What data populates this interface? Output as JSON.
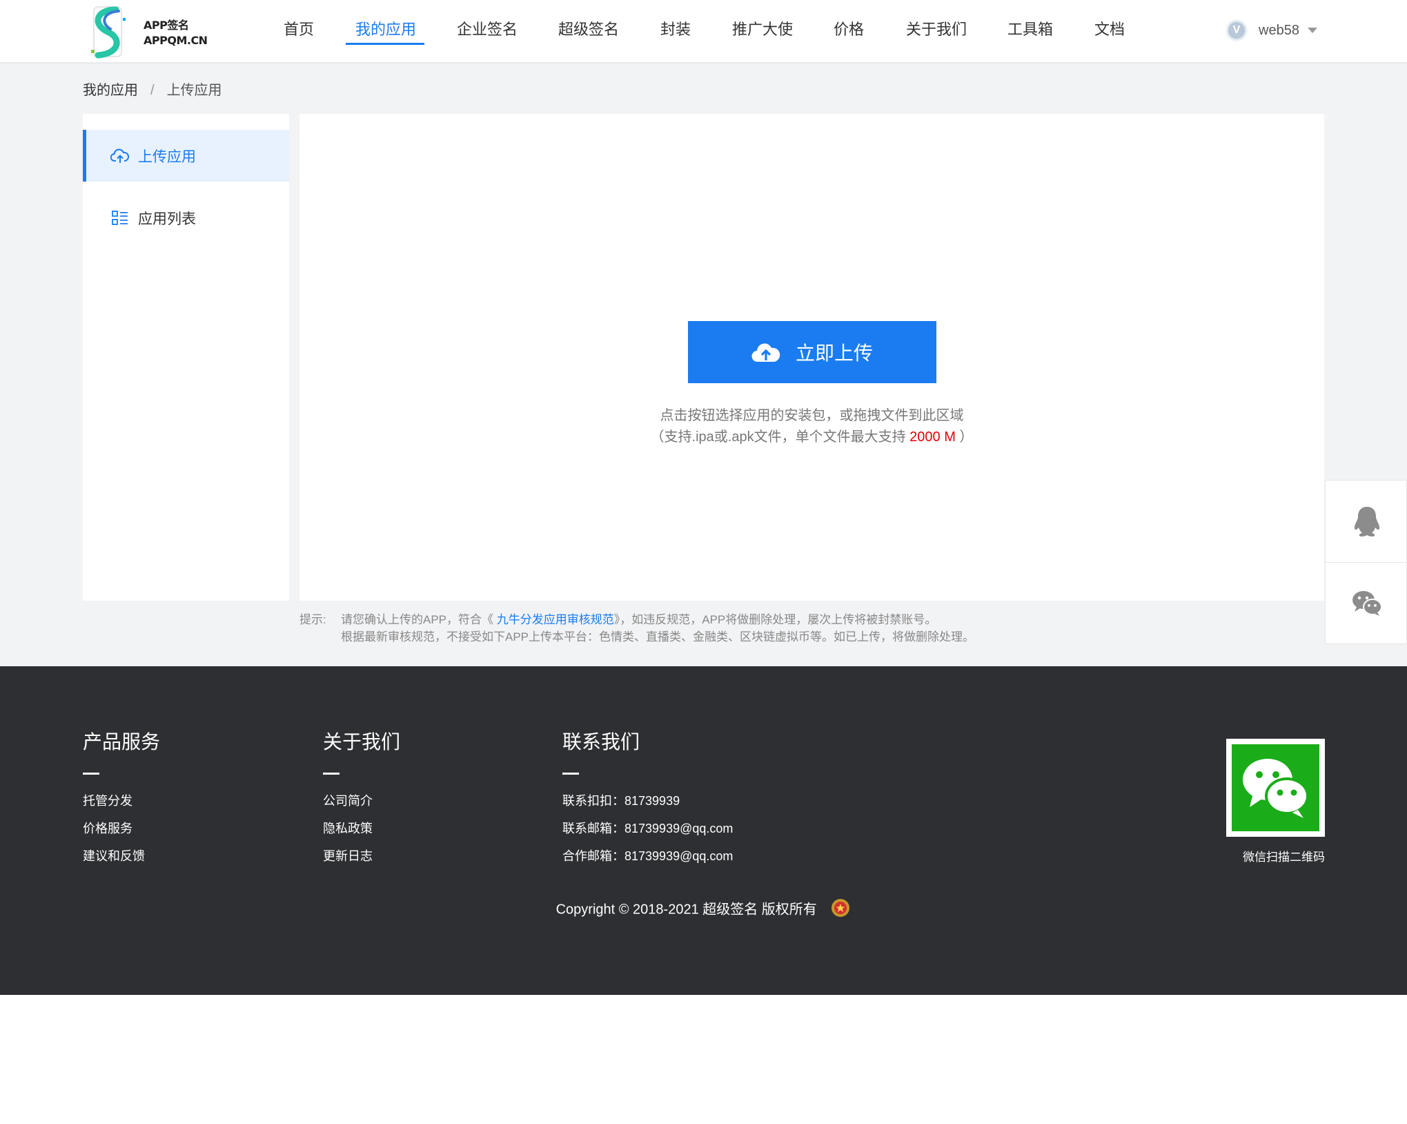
{
  "header": {
    "logo_line1": "APP签名",
    "logo_line2": "APPQM.CN",
    "nav": [
      {
        "label": "首页"
      },
      {
        "label": "我的应用"
      },
      {
        "label": "企业签名"
      },
      {
        "label": "超级签名"
      },
      {
        "label": "封装"
      },
      {
        "label": "推广大使"
      },
      {
        "label": "价格"
      },
      {
        "label": "关于我们"
      },
      {
        "label": "工具箱"
      },
      {
        "label": "文档"
      }
    ],
    "active_nav": "我的应用",
    "avatar_letter": "V",
    "username": "web58"
  },
  "breadcrumb": {
    "parent": "我的应用",
    "separator": "/",
    "current": "上传应用"
  },
  "sidebar": {
    "items": [
      {
        "label": "上传应用",
        "icon": "cloud-upload-icon",
        "active": true
      },
      {
        "label": "应用列表",
        "icon": "list-grid-icon",
        "active": false
      }
    ]
  },
  "upload": {
    "button_label": "立即上传",
    "hint_line1": "点击按钮选择应用的安装包，或拖拽文件到此区域",
    "hint_line2_prefix": "（支持.ipa或.apk文件，单个文件最大支持 ",
    "max_size": "2000 M",
    "hint_line2_suffix": " ）"
  },
  "tips": {
    "label": "提示:",
    "line1_prefix": "请您确认上传的APP，符合《 ",
    "link": "九牛分发应用审核规范",
    "line1_suffix": "》，如违反规范，APP将做删除处理，屡次上传将被封禁账号。",
    "line2": "根据最新审核规范，不接受如下APP上传本平台：色情类、直播类、金融类、区块链虚拟币等。如已上传，将做删除处理。"
  },
  "footer": {
    "columns": [
      {
        "title": "产品服务",
        "links": [
          "托管分发",
          "价格服务",
          "建议和反馈"
        ]
      },
      {
        "title": "关于我们",
        "links": [
          "公司简介",
          "隐私政策",
          "更新日志"
        ]
      },
      {
        "title": "联系我们",
        "links": [
          "联系扣扣：81739939",
          "联系邮箱：81739939@qq.com",
          "合作邮箱：81739939@qq.com"
        ]
      }
    ],
    "qr_caption": "微信扫描二维码",
    "copyright": "Copyright © 2018-2021 超级签名 版权所有"
  },
  "colors": {
    "accent": "#1a7cf0",
    "footer_bg": "#2e2f33",
    "page_bg": "#f2f3f5",
    "highlight_red": "#e8000b",
    "wechat_green": "#1aad19"
  }
}
